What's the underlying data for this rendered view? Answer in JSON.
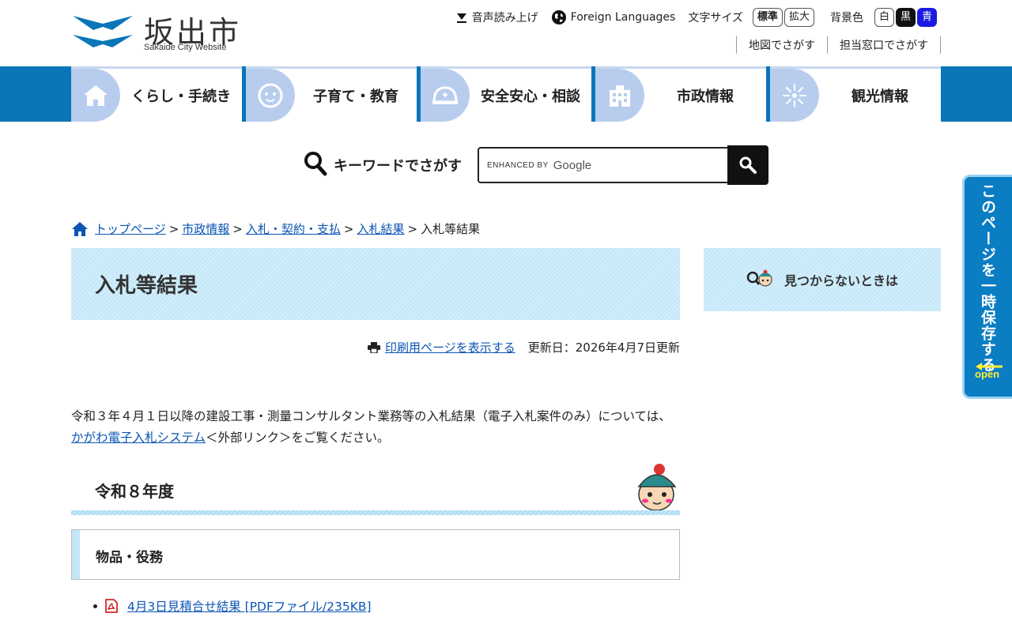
{
  "header": {
    "logo_jp": "坂出市",
    "logo_en": "Sakaide City Website",
    "voice_reader": "音声読み上げ",
    "foreign_languages": "Foreign Languages",
    "font_size_label": "文字サイズ",
    "font_size_standard": "標準",
    "font_size_large": "拡大",
    "bg_color_label": "背景色",
    "bg_white": "白",
    "bg_black": "黒",
    "bg_blue": "青",
    "map_search": "地図でさがす",
    "office_search": "担当窓口でさがす"
  },
  "nav": [
    {
      "label": "くらし・手続き",
      "icon": "house-icon"
    },
    {
      "label": "子育て・教育",
      "icon": "baby-icon"
    },
    {
      "label": "安全安心・相談",
      "icon": "helmet-icon"
    },
    {
      "label": "市政情報",
      "icon": "building-icon"
    },
    {
      "label": "観光情報",
      "icon": "firework-icon"
    }
  ],
  "search": {
    "label": "キーワードでさがす",
    "enhanced_by": "ENHANCED BY",
    "google": "Google"
  },
  "breadcrumb": {
    "items": [
      "トップページ",
      "市政情報",
      "入札・契約・支払",
      "入札結果"
    ],
    "current": "入札等結果",
    "separator": ">"
  },
  "page": {
    "title": "入札等結果",
    "print_link": "印刷用ページを表示する",
    "updated": "更新日：2026年4月7日更新",
    "intro_before": "令和３年４月１日以降の建設工事・測量コンサルタント業務等の入札結果（電子入札案件のみ）については、",
    "intro_link": "かがわ電子入札システム",
    "intro_after": "＜外部リンク＞をご覧ください。",
    "section_title": "令和８年度",
    "subsection_title": "物品・役務",
    "files": [
      {
        "label": "4月3日見積合せ結果 [PDFファイル/235KB]"
      }
    ]
  },
  "sidebar": {
    "not_found": "見つからないときは"
  },
  "save_tab": {
    "label": "このページを一時保存する",
    "open": "open"
  }
}
